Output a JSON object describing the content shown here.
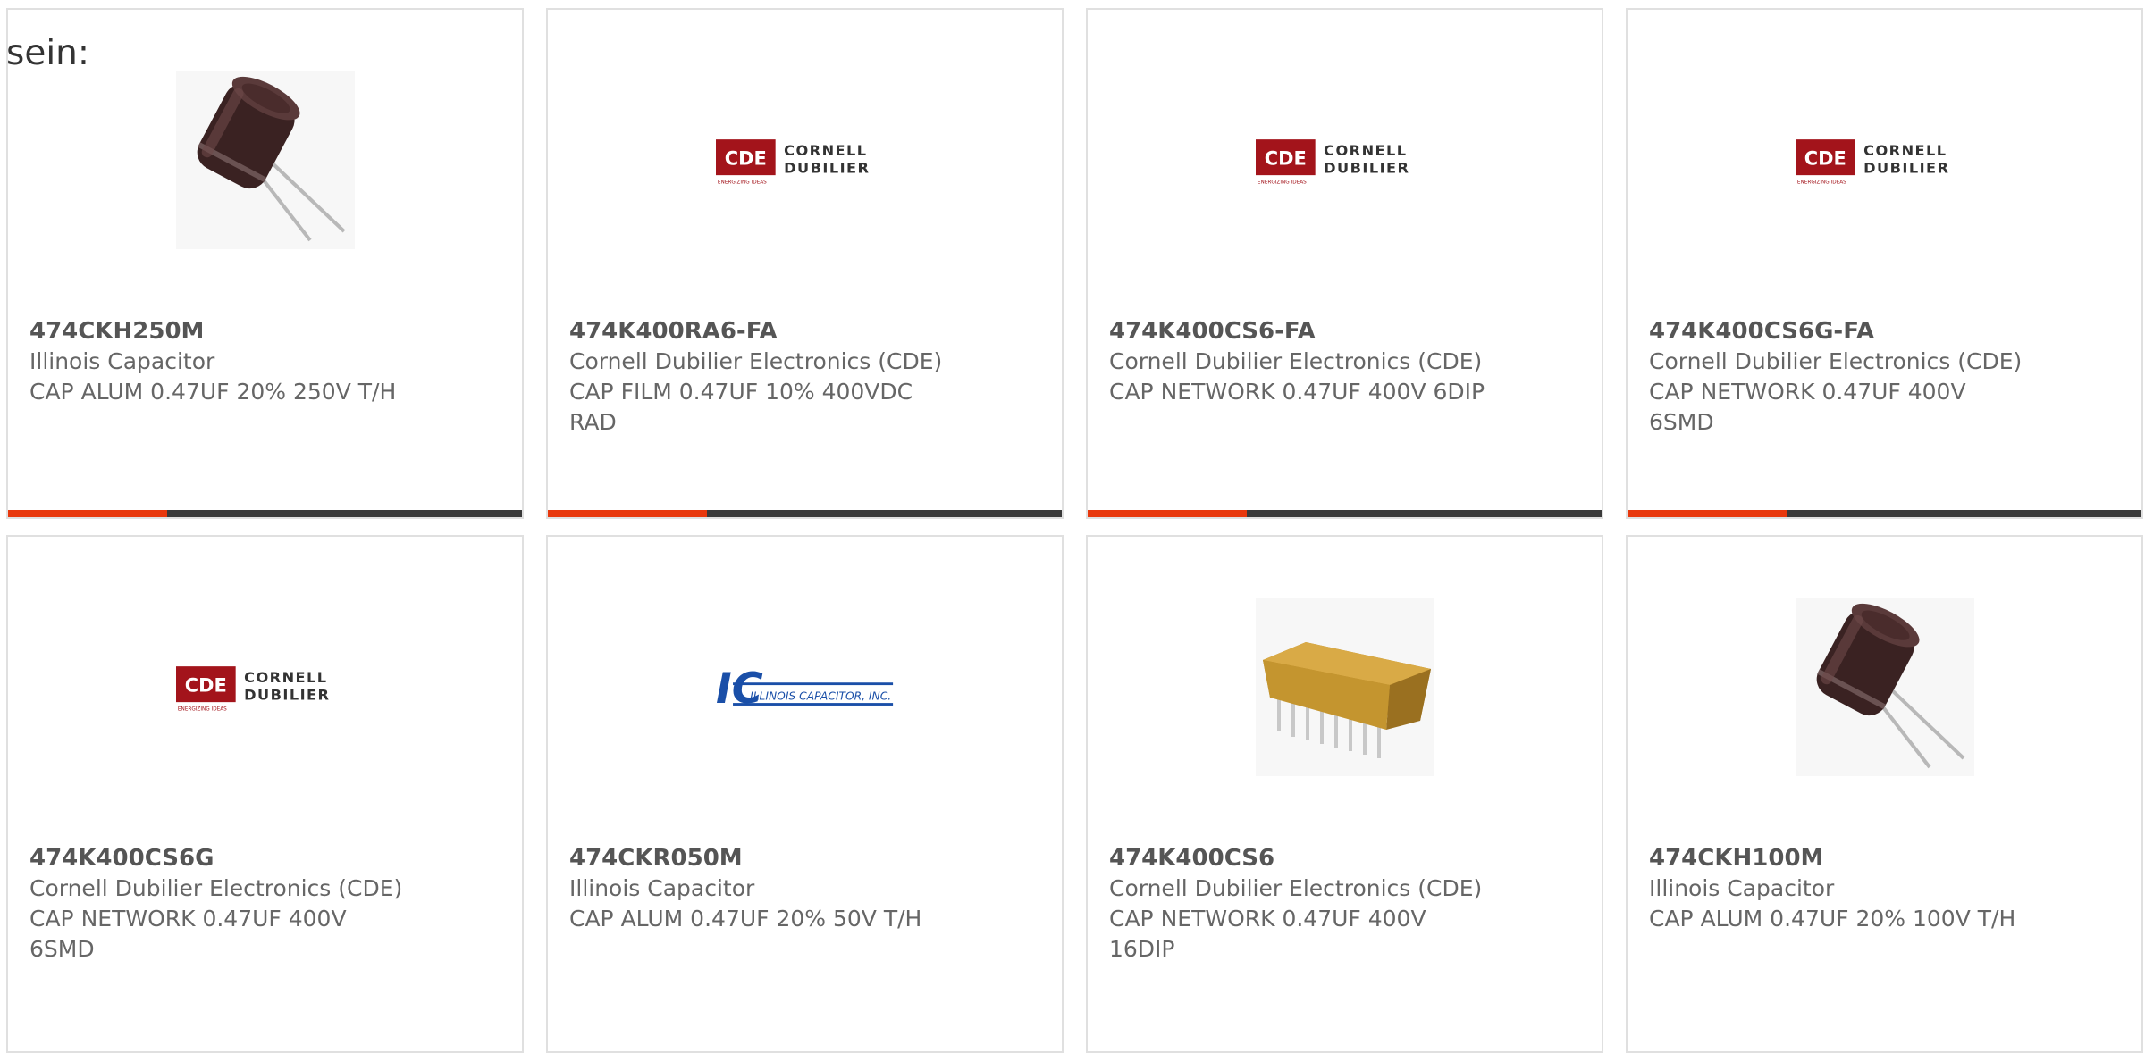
{
  "intro_text": "sein:",
  "colors": {
    "accent": "#e8380d",
    "bar_rest": "#3a3a3a",
    "cde_red": "#a3141b",
    "ic_blue": "#1a4fa8"
  },
  "progress_fraction": 0.31,
  "cards": [
    {
      "part": "474CKH250M",
      "manufacturer": "Illinois Capacitor",
      "description": "CAP ALUM 0.47UF 20% 250V T/H",
      "image": "electrolytic-capacitor-photo"
    },
    {
      "part": "474K400RA6-FA",
      "manufacturer": "Cornell Dubilier Electronics (CDE)",
      "description": "CAP FILM 0.47UF 10% 400VDC RAD",
      "image": "cde-logo"
    },
    {
      "part": "474K400CS6-FA",
      "manufacturer": "Cornell Dubilier Electronics (CDE)",
      "description": "CAP NETWORK 0.47UF 400V 6DIP",
      "image": "cde-logo"
    },
    {
      "part": "474K400CS6G-FA",
      "manufacturer": "Cornell Dubilier Electronics (CDE)",
      "description": "CAP NETWORK 0.47UF 400V 6SMD",
      "image": "cde-logo"
    },
    {
      "part": "474K400CS6G",
      "manufacturer": "Cornell Dubilier Electronics (CDE)",
      "description": "CAP NETWORK 0.47UF 400V 6SMD",
      "image": "cde-logo"
    },
    {
      "part": "474CKR050M",
      "manufacturer": "Illinois Capacitor",
      "description": "CAP ALUM 0.47UF 20% 50V T/H",
      "image": "illinois-capacitor-logo"
    },
    {
      "part": "474K400CS6",
      "manufacturer": "Cornell Dubilier Electronics (CDE)",
      "description": "CAP NETWORK 0.47UF 400V 16DIP",
      "image": "network-capacitor-photo"
    },
    {
      "part": "474CKH100M",
      "manufacturer": "Illinois Capacitor",
      "description": "CAP ALUM 0.47UF 20% 100V T/H",
      "image": "electrolytic-capacitor-photo"
    }
  ],
  "logos": {
    "cde": {
      "badge": "CDE",
      "line1": "CORNELL",
      "line2": "DUBILIER",
      "tagline": "ENERGIZING IDEAS"
    },
    "ic": {
      "mark": "IC",
      "name": "ILLINOIS CAPACITOR, INC."
    }
  }
}
